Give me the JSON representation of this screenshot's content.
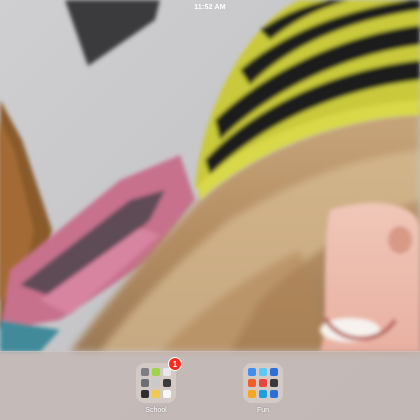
{
  "status_bar": {
    "time": "11:52 AM"
  },
  "wallpaper": {
    "description_icon": "photo-wallpaper"
  },
  "dock": {
    "folders": [
      {
        "label": "School",
        "badge": "1",
        "icon": "folder-icon",
        "mini_icons": [
          "#7a7f86",
          "#9fd34a",
          "#e8e8ea",
          "#6b6f75",
          "#c9c9cc",
          "#3a3a3c",
          "#2e2e30",
          "#f2c94c",
          "#f7f7f7"
        ]
      },
      {
        "label": "Fun",
        "icon": "folder-icon",
        "mini_icons": [
          "#3e8ff0",
          "#5ac8fa",
          "#2d6fd6",
          "#f25c2a",
          "#e8463c",
          "#3a3a3c",
          "#f5a623",
          "#1a9fe0",
          "#2d6fd6"
        ]
      }
    ]
  },
  "colors": {
    "badge": "#ff2a1d",
    "dock": "#c4b6b2"
  }
}
